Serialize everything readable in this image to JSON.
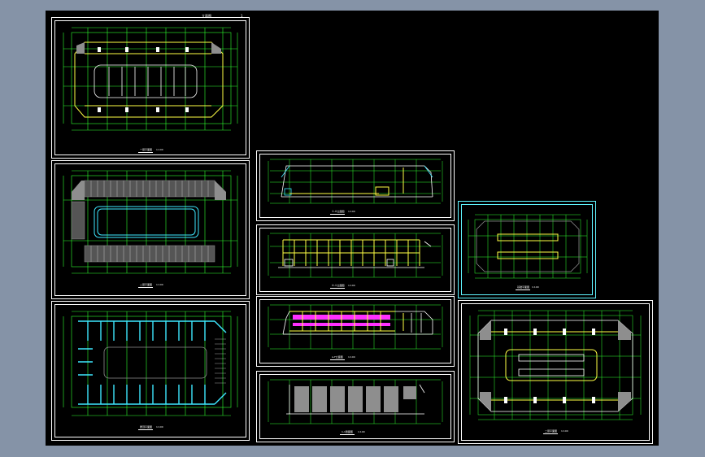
{
  "window": {
    "background": "#8593a7",
    "canvas_color": "#000000"
  },
  "header": {
    "title": "立面图",
    "page": "1"
  },
  "colors": {
    "grid": "#2eff2e",
    "wall_yellow": "#ffff44",
    "wall_white": "#ffffff",
    "cyan": "#3ee8ff",
    "magenta": "#ff30ff",
    "gray": "#8e8e8e",
    "sheet_border": "#ffffff",
    "sheet_border_alt": "#5ff4ff"
  },
  "sheets": [
    {
      "id": "sheet-1",
      "title": "一层平面图",
      "scale": "1:100"
    },
    {
      "id": "sheet-2",
      "title": "二层平面图",
      "scale": "1:100"
    },
    {
      "id": "sheet-3",
      "title": "屋顶平面图",
      "scale": "1:100"
    },
    {
      "id": "sheet-4",
      "title": "①-⑩立面图",
      "scale": "1:100"
    },
    {
      "id": "sheet-5",
      "title": "⑩-①立面图",
      "scale": "1:100"
    },
    {
      "id": "sheet-6",
      "title": "A-F立面图",
      "scale": "1:100"
    },
    {
      "id": "sheet-7",
      "title": "1-1剖面图",
      "scale": "1:100"
    },
    {
      "id": "sheet-8",
      "title": "基础平面图",
      "scale": "1:100"
    },
    {
      "id": "sheet-9",
      "title": "二层平面图",
      "scale": "1:100"
    }
  ]
}
